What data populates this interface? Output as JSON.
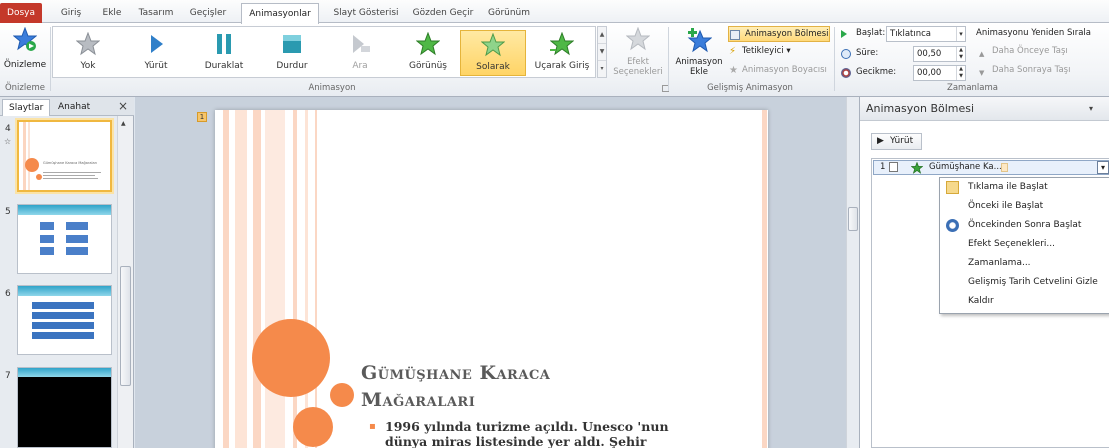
{
  "tabs": {
    "file": "Dosya",
    "items": [
      "Giriş",
      "Ekle",
      "Tasarım",
      "Geçişler",
      "Animasyonlar",
      "Slayt Gösterisi",
      "Gözden Geçir",
      "Görünüm"
    ],
    "active": "Animasyonlar"
  },
  "ribbon": {
    "preview": {
      "label": "Önizleme",
      "group": "Önizleme"
    },
    "animation_gallery": {
      "group": "Animasyon",
      "items": [
        "Yok",
        "Yürüt",
        "Duraklat",
        "Durdur",
        "Ara",
        "Görünüş",
        "Solarak",
        "Uçarak Giriş"
      ],
      "selected": "Solarak",
      "disabled": [
        "Ara"
      ]
    },
    "effect_options": {
      "label_line1": "Efekt",
      "label_line2": "Seçenekleri",
      "disabled": true
    },
    "advanced": {
      "group": "Gelişmiş Animasyon",
      "add_animation_line1": "Animasyon",
      "add_animation_line2": "Ekle",
      "animation_pane": "Animasyon Bölmesi",
      "trigger": "Tetikleyici",
      "animation_painter": "Animasyon Boyacısı"
    },
    "timing": {
      "group": "Zamanlama",
      "start_label": "Başlat:",
      "start_value": "Tıklatınca",
      "duration_label": "Süre:",
      "duration_value": "00,50",
      "delay_label": "Gecikme:",
      "delay_value": "00,00",
      "reorder_title": "Animasyonu Yeniden Sırala",
      "move_earlier": "Daha Önceye Taşı",
      "move_later": "Daha Sonraya Taşı"
    }
  },
  "left_pane": {
    "tab_slides": "Slaytlar",
    "tab_outline": "Anahat",
    "close": "×",
    "slides": [
      {
        "number": "4",
        "selected": true
      },
      {
        "number": "5",
        "selected": false
      },
      {
        "number": "6",
        "selected": false
      },
      {
        "number": "7",
        "selected": false
      }
    ],
    "thumb4_title": "Gümüşhane Karaca Mağaraları"
  },
  "slide": {
    "marker": "1",
    "title_line1": "Gümüşhane Karaca",
    "title_line2": "Mağaraları",
    "bullet": "▪",
    "body_line1": "1996 yılında turizme açıldı. Unesco 'nun",
    "body_line2": "dünya miras listesinde yer aldı. Şehir"
  },
  "animation_pane": {
    "title": "Animasyon Bölmesi",
    "play": "Yürüt",
    "item": {
      "order": "1",
      "name": "Gümüşhane Ka..."
    },
    "menu": [
      "Tıklama ile Başlat",
      "Önceki ile Başlat",
      "Öncekinden Sonra Başlat",
      "Efekt Seçenekleri...",
      "Zamanlama...",
      "Gelişmiş Tarih Cetvelini Gizle",
      "Kaldır"
    ]
  },
  "colors": {
    "file_tab": "#c4382a",
    "accent_orange": "#f58a4b",
    "selected_gallery": "#ffd466",
    "star_green": "#3aa33a"
  }
}
